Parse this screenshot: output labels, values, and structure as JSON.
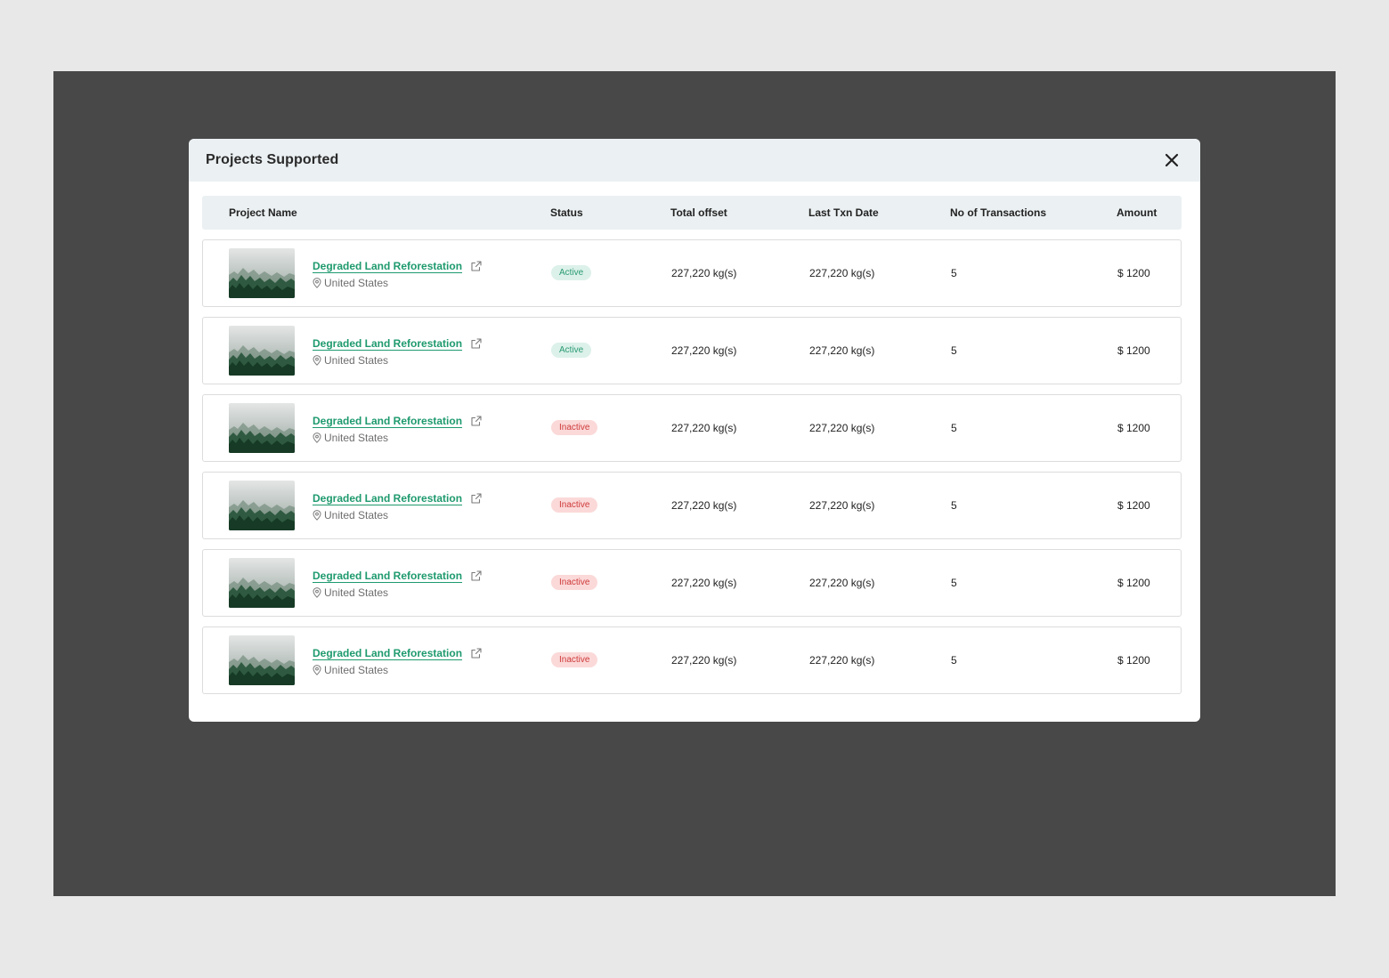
{
  "modal": {
    "title": "Projects Supported"
  },
  "table": {
    "columns": {
      "name": "Project Name",
      "status": "Status",
      "offset": "Total offset",
      "date": "Last Txn Date",
      "txn": "No of Transactions",
      "amount": "Amount"
    },
    "rows": [
      {
        "name": "Degraded Land Reforestation",
        "location": "United States",
        "status": "Active",
        "status_type": "active",
        "offset": "227,220 kg(s)",
        "date": "227,220 kg(s)",
        "txn": "5",
        "amount": "$ 1200"
      },
      {
        "name": "Degraded Land Reforestation",
        "location": "United States",
        "status": "Active",
        "status_type": "active",
        "offset": "227,220 kg(s)",
        "date": "227,220 kg(s)",
        "txn": "5",
        "amount": "$ 1200"
      },
      {
        "name": "Degraded Land Reforestation",
        "location": "United States",
        "status": "Inactive",
        "status_type": "inactive",
        "offset": "227,220 kg(s)",
        "date": "227,220 kg(s)",
        "txn": "5",
        "amount": "$ 1200"
      },
      {
        "name": "Degraded Land Reforestation",
        "location": "United States",
        "status": "Inactive",
        "status_type": "inactive",
        "offset": "227,220 kg(s)",
        "date": "227,220 kg(s)",
        "txn": "5",
        "amount": "$ 1200"
      },
      {
        "name": "Degraded Land Reforestation",
        "location": "United States",
        "status": "Inactive",
        "status_type": "inactive",
        "offset": "227,220 kg(s)",
        "date": "227,220 kg(s)",
        "txn": "5",
        "amount": "$ 1200"
      },
      {
        "name": "Degraded Land Reforestation",
        "location": "United States",
        "status": "Inactive",
        "status_type": "inactive",
        "offset": "227,220 kg(s)",
        "date": "227,220 kg(s)",
        "txn": "5",
        "amount": "$ 1200"
      }
    ]
  },
  "icons": {
    "close": "close-icon",
    "external_link": "external-link-icon",
    "location": "map-pin-icon",
    "thumbnail": "forest-image"
  },
  "colors": {
    "link": "#1e9a6e",
    "active_bg": "#dcf1ea",
    "active_text": "#2a9b72",
    "inactive_bg": "#fbd9d9",
    "inactive_text": "#cf3a3a",
    "header_bg": "#ebf0f2",
    "backdrop": "#484848"
  }
}
